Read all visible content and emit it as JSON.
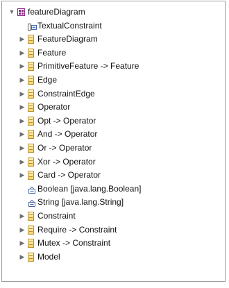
{
  "tree": {
    "root": {
      "label": "featureDiagram",
      "icon": "package-icon",
      "expanded": true
    },
    "children": [
      {
        "label": "TextualConstraint",
        "icon": "annotation-icon",
        "expandable": false
      },
      {
        "label": "FeatureDiagram",
        "icon": "class-icon",
        "expandable": true
      },
      {
        "label": "Feature",
        "icon": "class-icon",
        "expandable": true
      },
      {
        "label": "PrimitiveFeature -> Feature",
        "icon": "class-icon",
        "expandable": true
      },
      {
        "label": "Edge",
        "icon": "class-icon",
        "expandable": true
      },
      {
        "label": "ConstraintEdge",
        "icon": "class-icon",
        "expandable": true
      },
      {
        "label": "Operator",
        "icon": "class-icon",
        "expandable": true
      },
      {
        "label": "Opt -> Operator",
        "icon": "class-icon",
        "expandable": true
      },
      {
        "label": "And -> Operator",
        "icon": "class-icon",
        "expandable": true
      },
      {
        "label": "Or -> Operator",
        "icon": "class-icon",
        "expandable": true
      },
      {
        "label": "Xor -> Operator",
        "icon": "class-icon",
        "expandable": true
      },
      {
        "label": "Card -> Operator",
        "icon": "class-icon",
        "expandable": true
      },
      {
        "label": "Boolean [java.lang.Boolean]",
        "icon": "datatype-icon",
        "expandable": false
      },
      {
        "label": "String [java.lang.String]",
        "icon": "datatype-icon",
        "expandable": false
      },
      {
        "label": "Constraint",
        "icon": "class-icon",
        "expandable": true
      },
      {
        "label": "Require -> Constraint",
        "icon": "class-icon",
        "expandable": true
      },
      {
        "label": "Mutex -> Constraint",
        "icon": "class-icon",
        "expandable": true
      },
      {
        "label": "Model",
        "icon": "class-icon",
        "expandable": true
      }
    ]
  },
  "glyphs": {
    "expanded": "▼",
    "collapsed": "▶"
  },
  "colors": {
    "class_border": "#b98c2a",
    "package": "#8a2a8a",
    "arrow": "#6f6f6f"
  }
}
